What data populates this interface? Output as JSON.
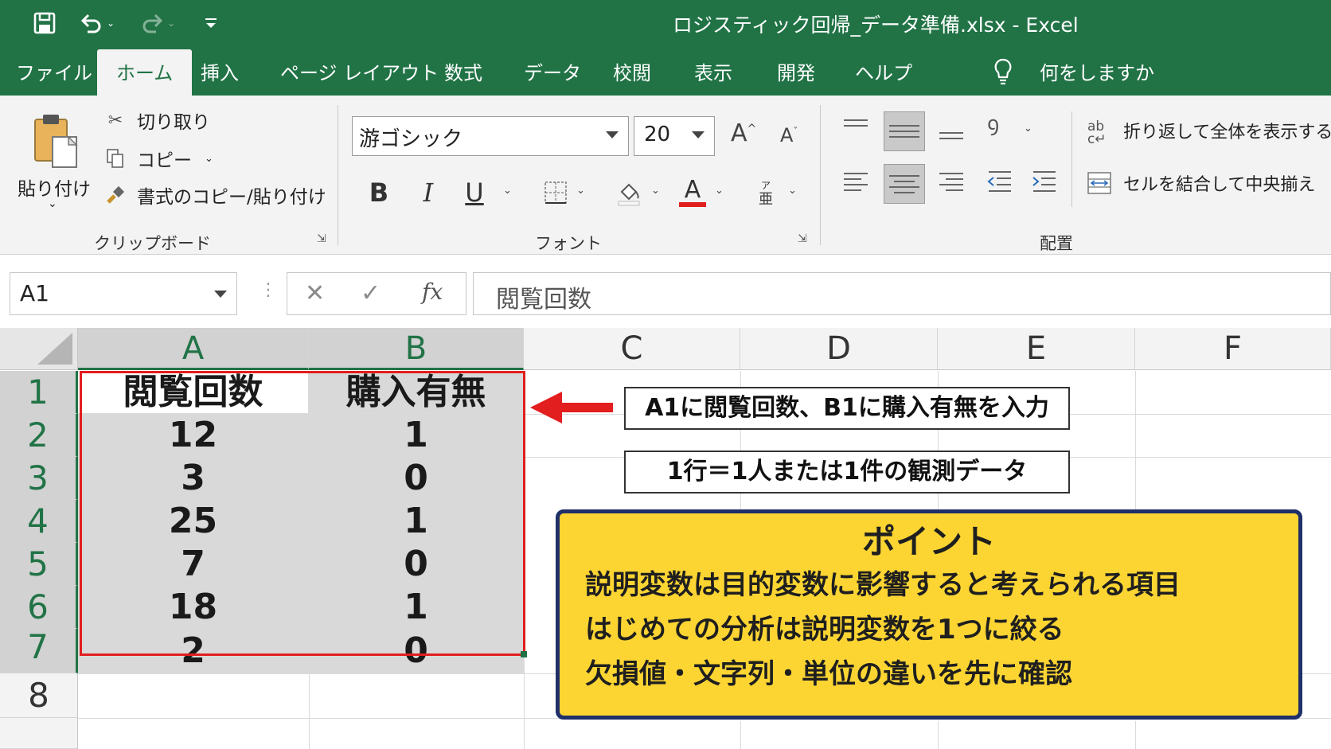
{
  "window": {
    "title": "ロジスティック回帰_データ準備.xlsx  -  Excel"
  },
  "menu": {
    "tabs": [
      "ファイル",
      "ホーム",
      "挿入",
      "ページ レイアウト",
      "数式",
      "データ",
      "校閲",
      "表示",
      "開発",
      "ヘルプ"
    ],
    "active_tab": "ホーム",
    "tell_me": "何をしますか"
  },
  "ribbon": {
    "clipboard": {
      "paste": "貼り付け",
      "cut": "切り取り",
      "copy": "コピー",
      "format_painter": "書式のコピー/貼り付け",
      "label": "クリップボード"
    },
    "font": {
      "name": "游ゴシック",
      "size": "20",
      "label": "フォント",
      "bold": "B",
      "italic": "I",
      "underline": "U",
      "font_color": "A",
      "grow": "A",
      "shrink": "A",
      "phonetic": "亜"
    },
    "alignment": {
      "wrap_text": "折り返して全体を表示する",
      "merge_center": "セルを結合して中央揃え",
      "label": "配置"
    }
  },
  "formula_bar": {
    "name_box": "A1",
    "cancel": "✕",
    "enter": "✓",
    "fx": "fx",
    "content": "閲覧回数"
  },
  "sheet": {
    "columns": [
      "A",
      "B",
      "C",
      "D",
      "E",
      "F"
    ],
    "rows": [
      "1",
      "2",
      "3",
      "4",
      "5",
      "6",
      "7",
      "8"
    ],
    "cells": [
      [
        "閲覧回数",
        "購入有無"
      ],
      [
        "12",
        "1"
      ],
      [
        "3",
        "0"
      ],
      [
        "25",
        "1"
      ],
      [
        "7",
        "0"
      ],
      [
        "18",
        "1"
      ],
      [
        "2",
        "0"
      ]
    ]
  },
  "annotations": {
    "callout1": "A1に閲覧回数、B1に購入有無を入力",
    "callout2": "1行＝1人または1件の観測データ",
    "point": {
      "title": "ポイント",
      "lines": [
        "説明変数は目的変数に影響すると考えられる項目",
        "はじめての分析は説明変数を1つに絞る",
        "欠損値・文字列・単位の違いを先に確認"
      ]
    }
  },
  "colors": {
    "excel_green": "#217346",
    "selection_red": "#e21e1e",
    "point_yellow": "#fcd533",
    "point_border": "#1f3069"
  },
  "icons": {
    "save": "save-icon",
    "undo": "undo-icon",
    "redo": "redo-icon",
    "lightbulb": "lightbulb-icon",
    "paste": "clipboard-icon",
    "cut": "scissors-icon",
    "copy": "copy-icon",
    "format_painter": "paintbrush-icon"
  }
}
